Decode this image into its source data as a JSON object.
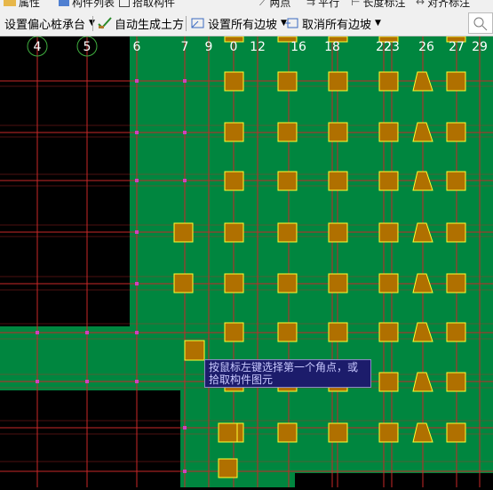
{
  "menu_row": [
    {
      "label": "属性",
      "icon": "properties-icon"
    },
    {
      "label": "构件列表",
      "icon": "component-list-icon"
    },
    {
      "label": "拾取构件",
      "icon": "pick-component-icon"
    },
    {
      "label": "两点",
      "icon": "two-point-icon"
    },
    {
      "label": "平行",
      "icon": "parallel-icon"
    },
    {
      "label": "长度标注",
      "icon": "length-dim-icon"
    },
    {
      "label": "对齐标注",
      "icon": "align-dim-icon"
    }
  ],
  "toolbar": {
    "set_eccentric_cap": "设置偏心桩承台",
    "auto_earthwork": "自动生成土方",
    "set_all_slopes": "设置所有边坡",
    "cancel_all_slopes": "取消所有边坡"
  },
  "axis_labels": [
    {
      "text": "4",
      "circled": true
    },
    {
      "text": "5",
      "circled": true
    },
    {
      "text": "6",
      "circled": false
    },
    {
      "text": "7",
      "circled": false
    },
    {
      "text": "9",
      "circled": false
    },
    {
      "text": "0",
      "circled": false
    },
    {
      "text": "12",
      "circled": false
    },
    {
      "text": "16",
      "circled": false
    },
    {
      "text": "18",
      "circled": false
    },
    {
      "text": "22",
      "circled": false
    },
    {
      "text": "23",
      "circled": false
    },
    {
      "text": "26",
      "circled": false
    },
    {
      "text": "27",
      "circled": false
    },
    {
      "text": "29",
      "circled": false
    }
  ],
  "tooltip": "按鼠标左键选择第一个角点，或拾取构件图元",
  "colors": {
    "canvas_bg": "#000000",
    "slab_green": "#00863f",
    "grid_red": "#c82828",
    "pile_cap_fill": "#b07000",
    "pile_cap_border": "#ffff33",
    "axis_label": "#ffffff",
    "tooltip_bg": "#1c1c6b"
  }
}
